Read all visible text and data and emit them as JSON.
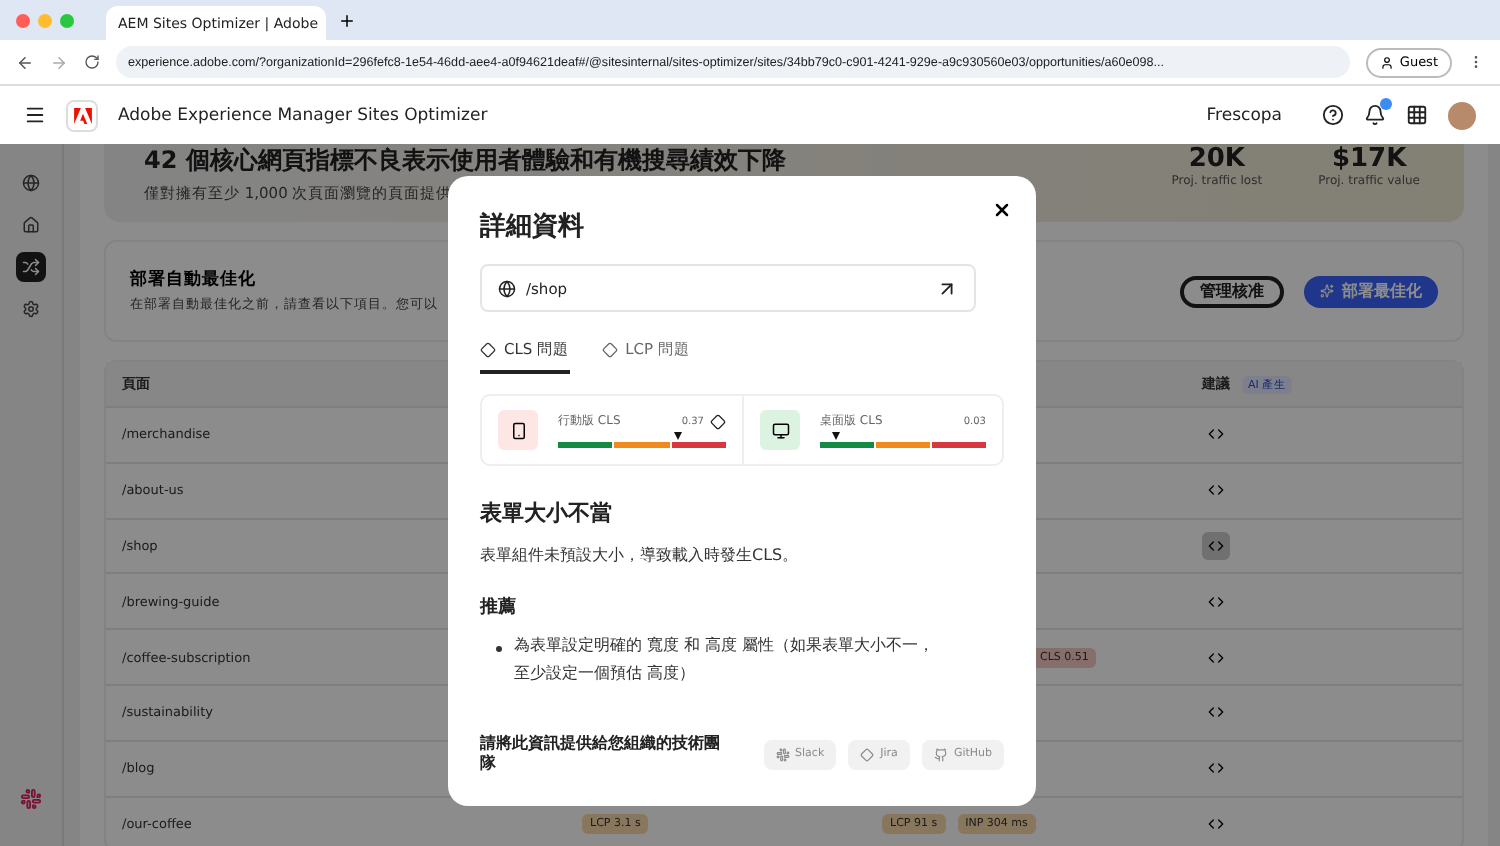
{
  "browser": {
    "tab_title": "AEM Sites Optimizer | Adobe",
    "url": "experience.adobe.com/?organizationId=296fefc8-1e54-46dd-aee4-a0f94621deaf#/@sitesinternal/sites-optimizer/sites/34bb79c0-c901-4241-929e-a9c930560e03/opportunities/a60e098...",
    "profile": "Guest"
  },
  "header": {
    "app_name": "Adobe Experience Manager Sites Optimizer",
    "org": "Frescopa",
    "notification_dot": true
  },
  "sidebar": {
    "items": [
      {
        "kind": "globe",
        "selected": false
      },
      {
        "kind": "home",
        "selected": false
      },
      {
        "kind": "opportunities",
        "selected": true
      },
      {
        "kind": "settings",
        "selected": false
      }
    ]
  },
  "banner": {
    "title": "42 個核心網頁指標不良表示使用者體驗和有機搜尋績效下降",
    "subtitle": "僅對擁有至少 1,000 次頁面瀏覽的頁面提供",
    "stats": [
      {
        "value": "20K",
        "label": "Proj. traffic lost"
      },
      {
        "value": "$17K",
        "label": "Proj. traffic value"
      }
    ]
  },
  "deploy_card": {
    "title": "部署自動最佳化",
    "subtitle": "在部署自動最佳化之前，請查看以下項目。您可以",
    "buttons": [
      {
        "label": "管理核准",
        "kind": "outline"
      },
      {
        "label": "部署最佳化",
        "kind": "primary"
      }
    ]
  },
  "table": {
    "columns": [
      "頁面",
      "建議"
    ],
    "ai_tag": "AI 產生",
    "rows": [
      {
        "page": "/merchandise",
        "selected": false
      },
      {
        "page": "/about-us",
        "selected": false
      },
      {
        "page": "/shop",
        "selected": true
      },
      {
        "page": "/brewing-guide",
        "selected": false
      },
      {
        "page": "/coffee-subscription",
        "selected": false,
        "column_4": [
          {
            "text": "CLS 0.51",
            "kind": "poor"
          }
        ]
      },
      {
        "page": "/sustainability",
        "selected": false
      },
      {
        "page": "/blog",
        "selected": false
      },
      {
        "page": "/our-coffee",
        "selected": false,
        "column_2": [
          {
            "text": "LCP 3.1 s",
            "kind": "needs_improvement"
          }
        ],
        "column_3": [
          {
            "text": "LCP 91 s",
            "kind": "needs_improvement"
          },
          {
            "text": "INP 304 ms",
            "kind": "needs_improvement"
          }
        ]
      }
    ]
  },
  "modal": {
    "title": "詳細資料",
    "url": "/shop",
    "tabs": [
      {
        "label": "CLS 問題",
        "selected": true
      },
      {
        "label": "LCP 問題",
        "selected": false
      }
    ],
    "metrics": [
      {
        "kind": "mobile",
        "label": "行動版 CLS",
        "reading": "0.37",
        "level": 0.72,
        "warning": true
      },
      {
        "kind": "desktop",
        "label": "桌面版 CLS",
        "reading": "0.03",
        "level": 0.1,
        "warning": false
      }
    ],
    "issue_title": "表單大小不當",
    "issue_text": "表單組件未預設大小，導致載入時發生CLS。",
    "recommend_title": "推薦",
    "recommendations": [
      "為表單設定明確的 寬度 和 高度 屬性（如果表單大小不一，至少設定一個預估 高度）"
    ],
    "share_text": "請將此資訊提供給您組織的技術團隊",
    "share_buttons": [
      {
        "label": "Slack",
        "kind": "slack",
        "disabled": true
      },
      {
        "label": "Jira",
        "kind": "jira",
        "disabled": true
      },
      {
        "label": "GitHub",
        "kind": "github",
        "disabled": true
      }
    ]
  }
}
